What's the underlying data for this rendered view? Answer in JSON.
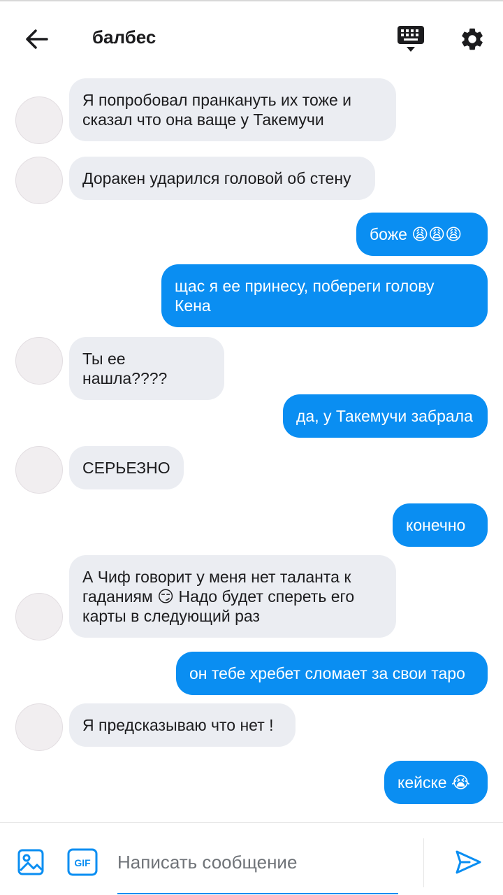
{
  "header": {
    "title": "балбес",
    "back_icon": "arrow-left-icon",
    "keyboard_icon": "keyboard-icon",
    "settings_icon": "gear-icon"
  },
  "messages": [
    {
      "side": "in",
      "text": "Я попробовал пранкануть их тоже и сказал что она ваще у Такемучи"
    },
    {
      "side": "in",
      "text": "Доракен ударился головой об стену"
    },
    {
      "side": "out",
      "text": "боже 😩😩😩"
    },
    {
      "side": "out",
      "text": "щас я ее принесу, побереги голову Кена"
    },
    {
      "side": "in",
      "text": "Ты ее нашла????"
    },
    {
      "side": "out",
      "text": "да, у Такемучи забрала"
    },
    {
      "side": "in",
      "text": "СЕРЬЕЗНО"
    },
    {
      "side": "out",
      "text": "конечно"
    },
    {
      "side": "in",
      "text": "А Чиф говорит у меня нет таланта к гаданиям 😏 Надо будет спереть его карты в следующий раз"
    },
    {
      "side": "out",
      "text": "он тебе хребет сломает за свои таро"
    },
    {
      "side": "in",
      "text": "Я предсказываю что нет !"
    },
    {
      "side": "out",
      "text": "кейске 😭"
    }
  ],
  "composer": {
    "placeholder": "Написать сообщение",
    "image_icon": "image-icon",
    "gif_icon": "gif-icon",
    "gif_label": "GIF",
    "send_icon": "send-icon"
  },
  "colors": {
    "accent": "#0a8ef2",
    "incoming_bubble": "#ebedf2",
    "icon_dark": "#1c1c1e"
  }
}
